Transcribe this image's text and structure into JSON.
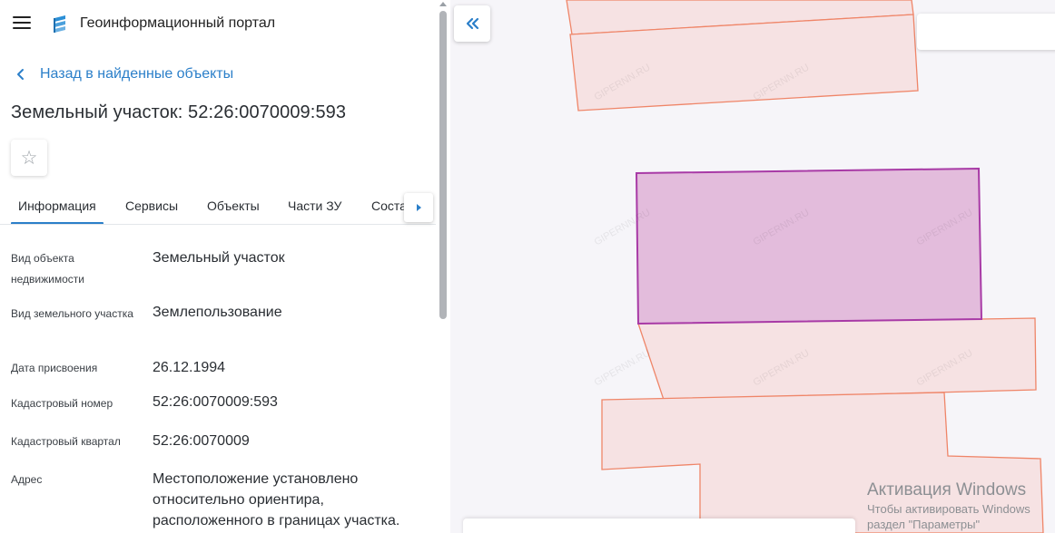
{
  "header": {
    "portal_title": "Геоинформационный портал"
  },
  "nav": {
    "back_label": "Назад в найденные объекты"
  },
  "object": {
    "title": "Земельный участок: 52:26:0070009:593"
  },
  "tabs": [
    {
      "label": "Информация",
      "active": true
    },
    {
      "label": "Сервисы",
      "active": false
    },
    {
      "label": "Объекты",
      "active": false
    },
    {
      "label": "Части ЗУ",
      "active": false
    },
    {
      "label": "Состав ЗУ",
      "active": false
    }
  ],
  "properties": [
    {
      "label": "Вид объекта недвижимости",
      "value": "Земельный участок"
    },
    {
      "label": "Вид земельного участка",
      "value": "Землепользование"
    },
    {
      "label": "Дата присвоения",
      "value": "26.12.1994"
    },
    {
      "label": "Кадастровый номер",
      "value": "52:26:0070009:593"
    },
    {
      "label": "Кадастровый квартал",
      "value": "52:26:0070009"
    },
    {
      "label": "Адрес",
      "value": "Местоположение установлено относительно ориентира, расположенного в границах участка."
    }
  ],
  "map": {
    "watermark": "GIPERNN.RU"
  },
  "windows_activation": {
    "title": "Активация Windows",
    "line1": "Чтобы активировать Windows",
    "line2": "раздел \"Параметры\""
  },
  "colors": {
    "accent": "#2b7fc9",
    "parcel_fill": "#f6e2e3",
    "parcel_stroke": "#ef8568",
    "selected_fill": "#e3bcdc",
    "selected_stroke": "#a83aa6"
  },
  "icons": {
    "menu": "hamburger-icon",
    "logo": "portal-logo-icon",
    "back": "chevron-left-icon",
    "favorite": "star-outline-icon",
    "tabs_next": "caret-right-icon",
    "collapse": "double-chevron-left-icon"
  }
}
